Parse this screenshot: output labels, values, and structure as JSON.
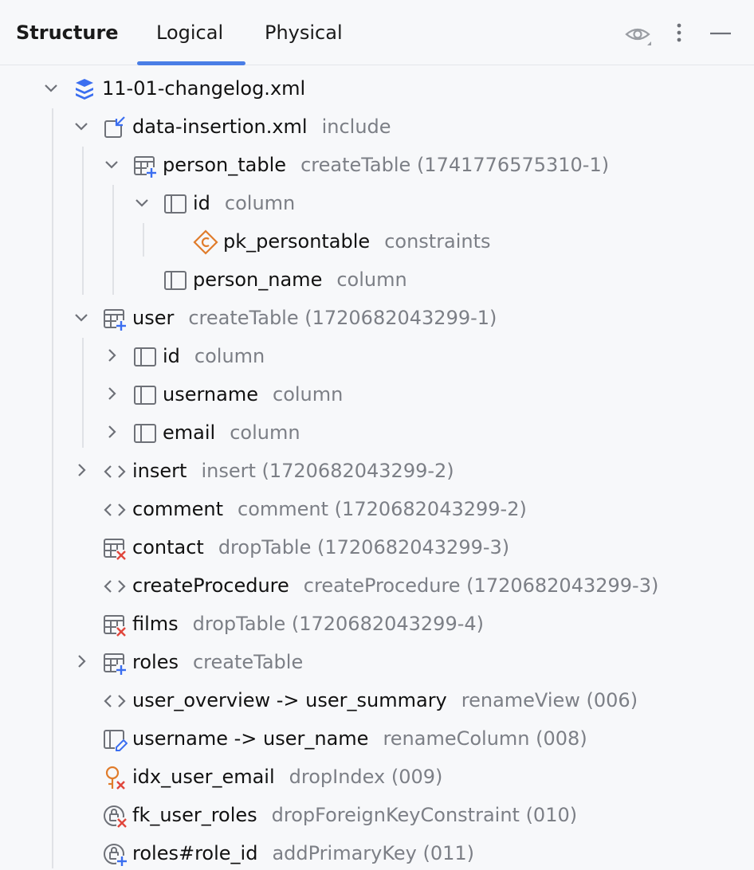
{
  "header": {
    "title": "Structure",
    "tabs": [
      {
        "label": "Logical",
        "selected": true
      },
      {
        "label": "Physical",
        "selected": false
      }
    ],
    "icons": [
      "eye-icon",
      "more-vertical-icon",
      "minimize-icon"
    ]
  },
  "colors": {
    "accent": "#4a7ee6",
    "hint_text": "#7c7f86",
    "changelog_icon": "#3b6ef0",
    "constraint_icon": "#e07c2b",
    "drop_red": "#e0463c",
    "add_blue": "#3b6ef0"
  },
  "tree": [
    {
      "name": "11-01-changelog.xml",
      "hint": "",
      "icon": "changelog-icon",
      "chevron": "expanded"
    },
    {
      "name": "data-insertion.xml",
      "hint": "include",
      "icon": "include-icon",
      "chevron": "expanded"
    },
    {
      "name": "person_table",
      "hint": "createTable (1741776575310-1)",
      "icon": "create-table-icon",
      "chevron": "expanded"
    },
    {
      "name": "id",
      "hint": "column",
      "icon": "column-icon",
      "chevron": "expanded"
    },
    {
      "name": "pk_persontable",
      "hint": "constraints",
      "icon": "constraint-icon",
      "chevron": "none"
    },
    {
      "name": "person_name",
      "hint": "column",
      "icon": "column-icon",
      "chevron": "none"
    },
    {
      "name": "user",
      "hint": "createTable (1720682043299-1)",
      "icon": "create-table-icon",
      "chevron": "expanded"
    },
    {
      "name": "id",
      "hint": "column",
      "icon": "column-icon",
      "chevron": "collapsed"
    },
    {
      "name": "username",
      "hint": "column",
      "icon": "column-icon",
      "chevron": "collapsed"
    },
    {
      "name": "email",
      "hint": "column",
      "icon": "column-icon",
      "chevron": "collapsed"
    },
    {
      "name": "insert",
      "hint": "insert (1720682043299-2)",
      "icon": "code-icon",
      "chevron": "collapsed"
    },
    {
      "name": "comment",
      "hint": "comment (1720682043299-2)",
      "icon": "code-icon",
      "chevron": "none"
    },
    {
      "name": "contact",
      "hint": "dropTable (1720682043299-3)",
      "icon": "drop-table-icon",
      "chevron": "none"
    },
    {
      "name": "createProcedure",
      "hint": "createProcedure (1720682043299-3)",
      "icon": "code-icon",
      "chevron": "none"
    },
    {
      "name": "films",
      "hint": "dropTable (1720682043299-4)",
      "icon": "drop-table-icon",
      "chevron": "none"
    },
    {
      "name": "roles",
      "hint": "createTable",
      "icon": "create-table-icon",
      "chevron": "collapsed"
    },
    {
      "name": "user_overview -> user_summary",
      "hint": "renameView (006)",
      "icon": "code-icon",
      "chevron": "none"
    },
    {
      "name": "username -> user_name",
      "hint": "renameColumn (008)",
      "icon": "rename-column-icon",
      "chevron": "none"
    },
    {
      "name": "idx_user_email",
      "hint": "dropIndex (009)",
      "icon": "drop-index-icon",
      "chevron": "none"
    },
    {
      "name": "fk_user_roles",
      "hint": "dropForeignKeyConstraint (010)",
      "icon": "drop-key-icon",
      "chevron": "none"
    },
    {
      "name": "roles#role_id",
      "hint": "addPrimaryKey (011)",
      "icon": "add-key-icon",
      "chevron": "none"
    }
  ]
}
